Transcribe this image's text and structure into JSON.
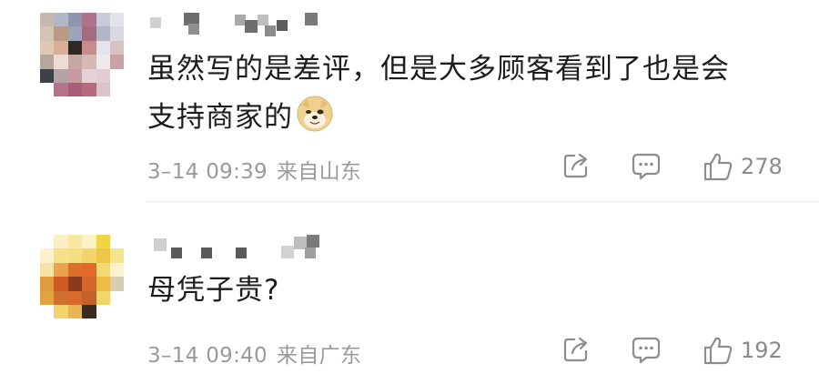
{
  "comments": [
    {
      "text_line1": "虽然写的是差评，但是大多顾客看到了也是会",
      "text_line2": "支持商家的",
      "emoji": "doge-emoji",
      "date": "3–14 09:39",
      "location": "来自山东",
      "likes": "278"
    },
    {
      "text_line1": "母凭子贵?",
      "date": "3–14 09:40",
      "location": "来自广东",
      "likes": "192"
    }
  ],
  "icons": {
    "share": "share-icon",
    "reply": "comment-icon",
    "like": "thumbs-up-icon"
  },
  "colors": {
    "text": "#1c1c1c",
    "meta": "#9a9a9a",
    "divider": "#ececec"
  }
}
